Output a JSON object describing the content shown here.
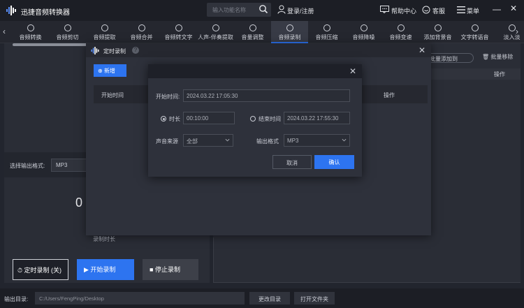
{
  "app": {
    "title": "迅捷音频转换器"
  },
  "search": {
    "placeholder": "输入功能名称"
  },
  "header": {
    "login": "登录/注册",
    "help": "帮助中心",
    "service": "客服",
    "menu": "菜单",
    "minimize": "—",
    "close": "✕"
  },
  "toolbar": {
    "items": [
      "音频转换",
      "音频剪切",
      "音频提取",
      "音频合并",
      "音频转文字",
      "人声-伴奏提取",
      "音量调整",
      "音频录制",
      "音频压缩",
      "音频降噪",
      "音频变速",
      "添加背景音",
      "文字转语音",
      "淡入淡"
    ],
    "active_index": 7
  },
  "left": {
    "format_label": "选择输出格式:",
    "format_value": "MP3",
    "big_number": "0",
    "record_duration": "录制时长"
  },
  "right": {
    "batch_add": "批量添加到",
    "batch_remove": "批量移除",
    "operation": "操作"
  },
  "buttons": {
    "timer": "定时录制 (关)",
    "start": "开始录制",
    "stop": "停止录制"
  },
  "bottom": {
    "output_label": "输出目录:",
    "output_path": "C:/Users/FengPing/Desktop",
    "change_dir": "更改目录",
    "open_folder": "打开文件夹"
  },
  "dialog1": {
    "title": "定时录制",
    "help": "?",
    "close": "✕",
    "new_btn": "新增",
    "col_start": "开始时间",
    "col_op": "操作"
  },
  "dialog2": {
    "close": "✕",
    "start_label": "开始时间:",
    "start_value": "2024.03.22 17:05:30",
    "duration_label": "时长",
    "duration_value": "00:10:00",
    "end_label": "结束时间",
    "end_value": "2024.03.22 17:55:30",
    "source_label": "声音来源",
    "source_value": "全部",
    "format_label": "输出格式",
    "format_value": "MP3",
    "cancel": "取消",
    "confirm": "确认"
  },
  "colors": {
    "accent": "#2d74f0",
    "background": "#22252e"
  }
}
